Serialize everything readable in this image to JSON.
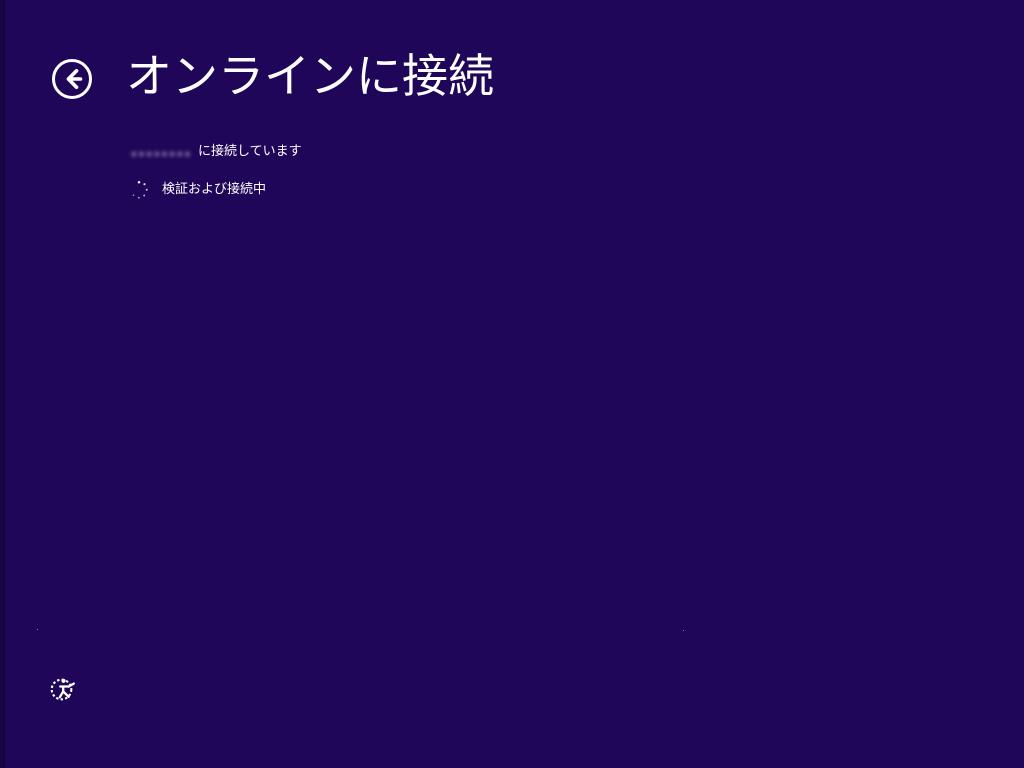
{
  "page": {
    "title": "オンラインに接続"
  },
  "status": {
    "network_name": "••••••••",
    "connecting_text": "に接続しています",
    "verification_text": "検証および接続中"
  },
  "icons": {
    "back": "back-arrow-icon",
    "progress": "loading-spinner-icon",
    "accessibility": "ease-of-access-icon"
  },
  "colors": {
    "background": "#1f0659",
    "text": "#ffffff"
  }
}
